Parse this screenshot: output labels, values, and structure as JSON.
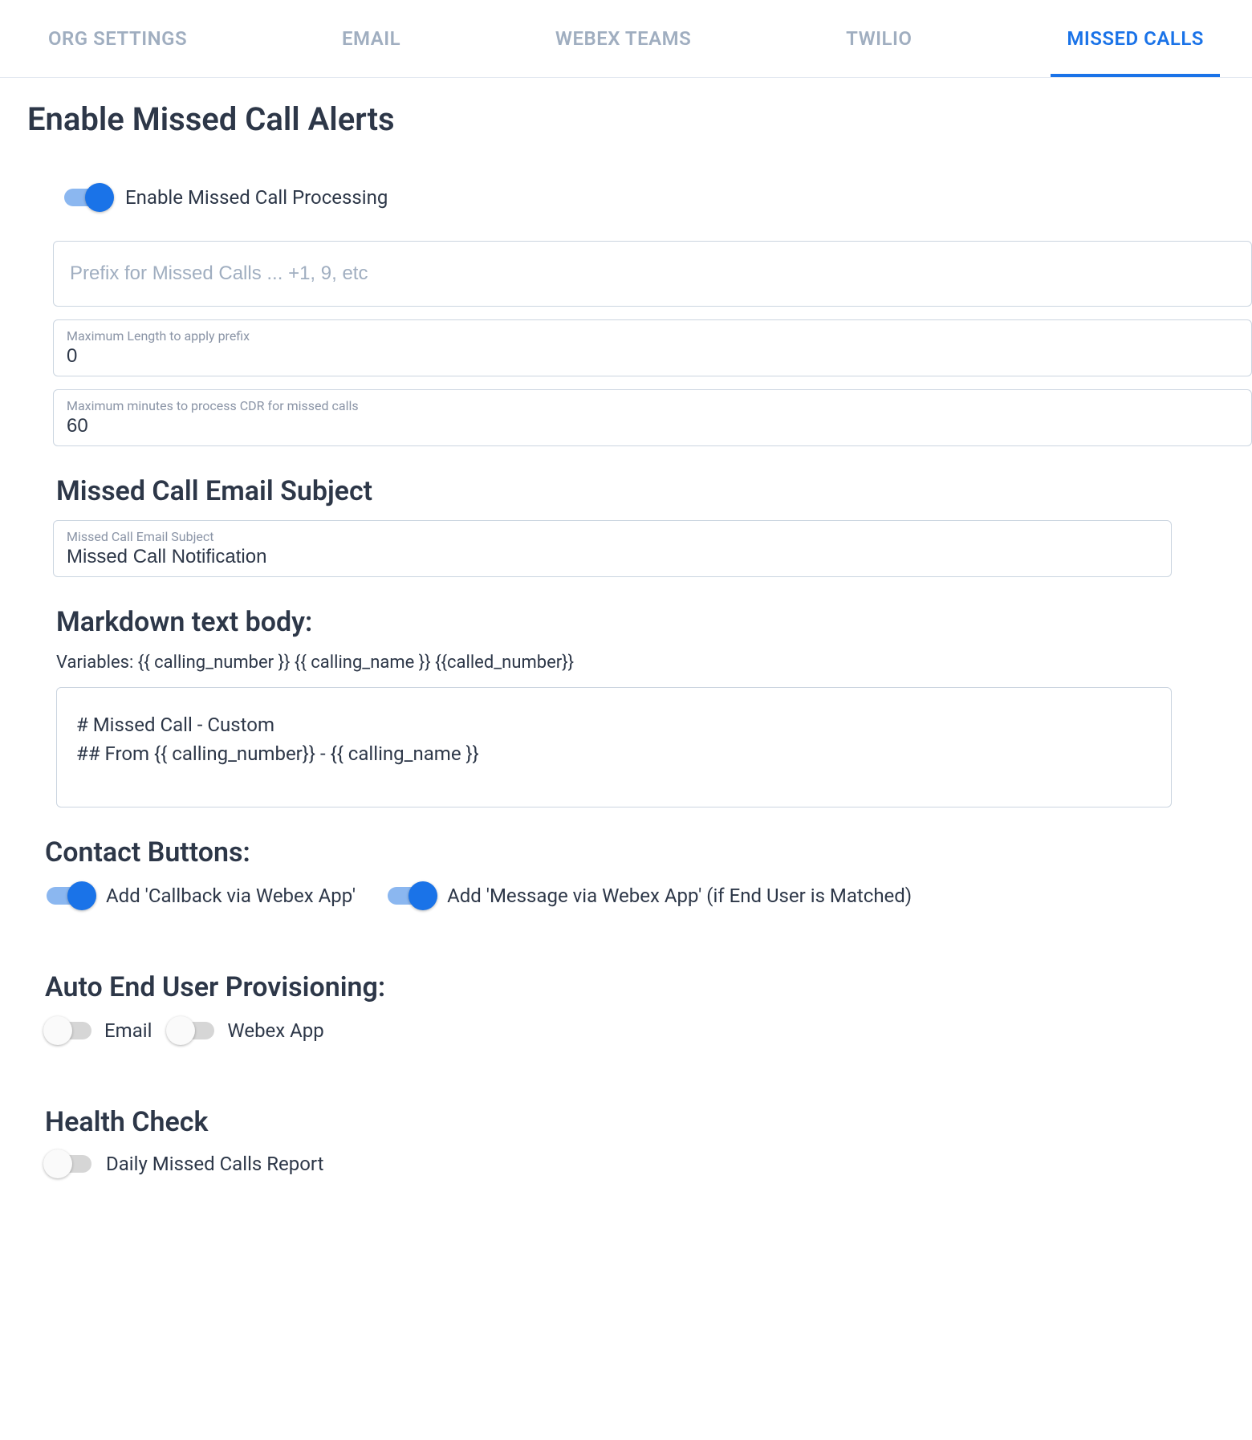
{
  "tabs": {
    "org_settings": "ORG SETTINGS",
    "email": "EMAIL",
    "webex_teams": "WEBEX TEAMS",
    "twilio": "TWILIO",
    "missed_calls": "MISSED CALLS"
  },
  "header": {
    "title": "Enable Missed Call Alerts"
  },
  "enable_toggle": {
    "label": "Enable Missed Call Processing",
    "on": true
  },
  "prefix_input": {
    "placeholder": "Prefix for Missed Calls ... +1, 9, etc",
    "value": ""
  },
  "max_length": {
    "label": "Maximum Length to apply prefix",
    "value": "0"
  },
  "max_minutes": {
    "label": "Maximum minutes to process CDR for missed calls",
    "value": "60"
  },
  "email_subject_section": {
    "title": "Missed Call Email Subject",
    "label": "Missed Call Email Subject",
    "value": "Missed Call Notification"
  },
  "markdown_section": {
    "title": "Markdown text body:",
    "variables": "Variables: {{ calling_number }} {{ calling_name }} {{called_number}}",
    "body": "# Missed Call - Custom\n## From {{ calling_number}} - {{ calling_name }}"
  },
  "contact_buttons": {
    "title": "Contact Buttons:",
    "callback": {
      "label": "Add 'Callback via Webex App'",
      "on": true
    },
    "message": {
      "label": "Add 'Message via Webex App' (if End User is Matched)",
      "on": true
    }
  },
  "auto_provisioning": {
    "title": "Auto End User Provisioning:",
    "email": {
      "label": "Email",
      "on": false
    },
    "webex": {
      "label": "Webex App",
      "on": false
    }
  },
  "health_check": {
    "title": "Health Check",
    "daily_report": {
      "label": "Daily Missed Calls Report",
      "on": false
    }
  }
}
